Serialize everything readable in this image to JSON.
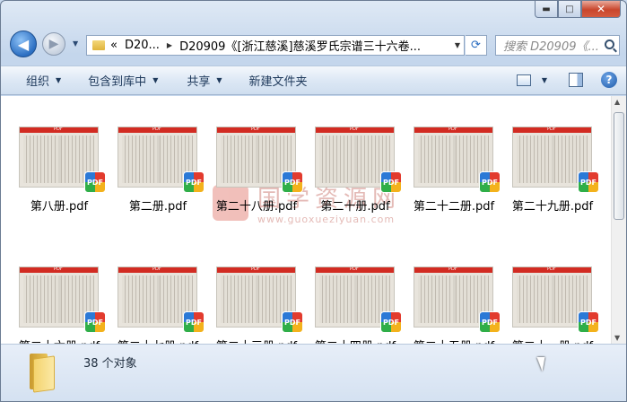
{
  "window": {
    "minimize_glyph": "▬",
    "maximize_glyph": "□",
    "close_glyph": "✕"
  },
  "nav": {
    "back_glyph": "◀",
    "forward_glyph": "▶",
    "breadcrumb_prefix": "«",
    "breadcrumbs": [
      "D20...",
      "D20909《[浙江慈溪]慈溪罗氏宗谱三十六卷..."
    ],
    "search_placeholder": "搜索 D20909《..."
  },
  "toolbar": {
    "organize": "组织",
    "include_library": "包含到库中",
    "share": "共享",
    "new_folder": "新建文件夹",
    "help_glyph": "?"
  },
  "files": [
    {
      "name": "第八册.pdf"
    },
    {
      "name": "第二册.pdf"
    },
    {
      "name": "第二十八册.pdf"
    },
    {
      "name": "第二十册.pdf"
    },
    {
      "name": "第二十二册.pdf"
    },
    {
      "name": "第二十九册.pdf"
    },
    {
      "name": "第二十六册.pdf"
    },
    {
      "name": "第二十七册.pdf"
    },
    {
      "name": "第二十三册.pdf"
    },
    {
      "name": "第二十四册.pdf"
    },
    {
      "name": "第二十五册.pdf"
    },
    {
      "name": "第二十一册.pdf"
    }
  ],
  "file_thumb_label": "PDF",
  "pdf_badge": "PDF",
  "watermark": {
    "cn": "国学资源网",
    "url": "www.guoxueziyuan.com"
  },
  "status": {
    "count_text": "38 个对象"
  }
}
